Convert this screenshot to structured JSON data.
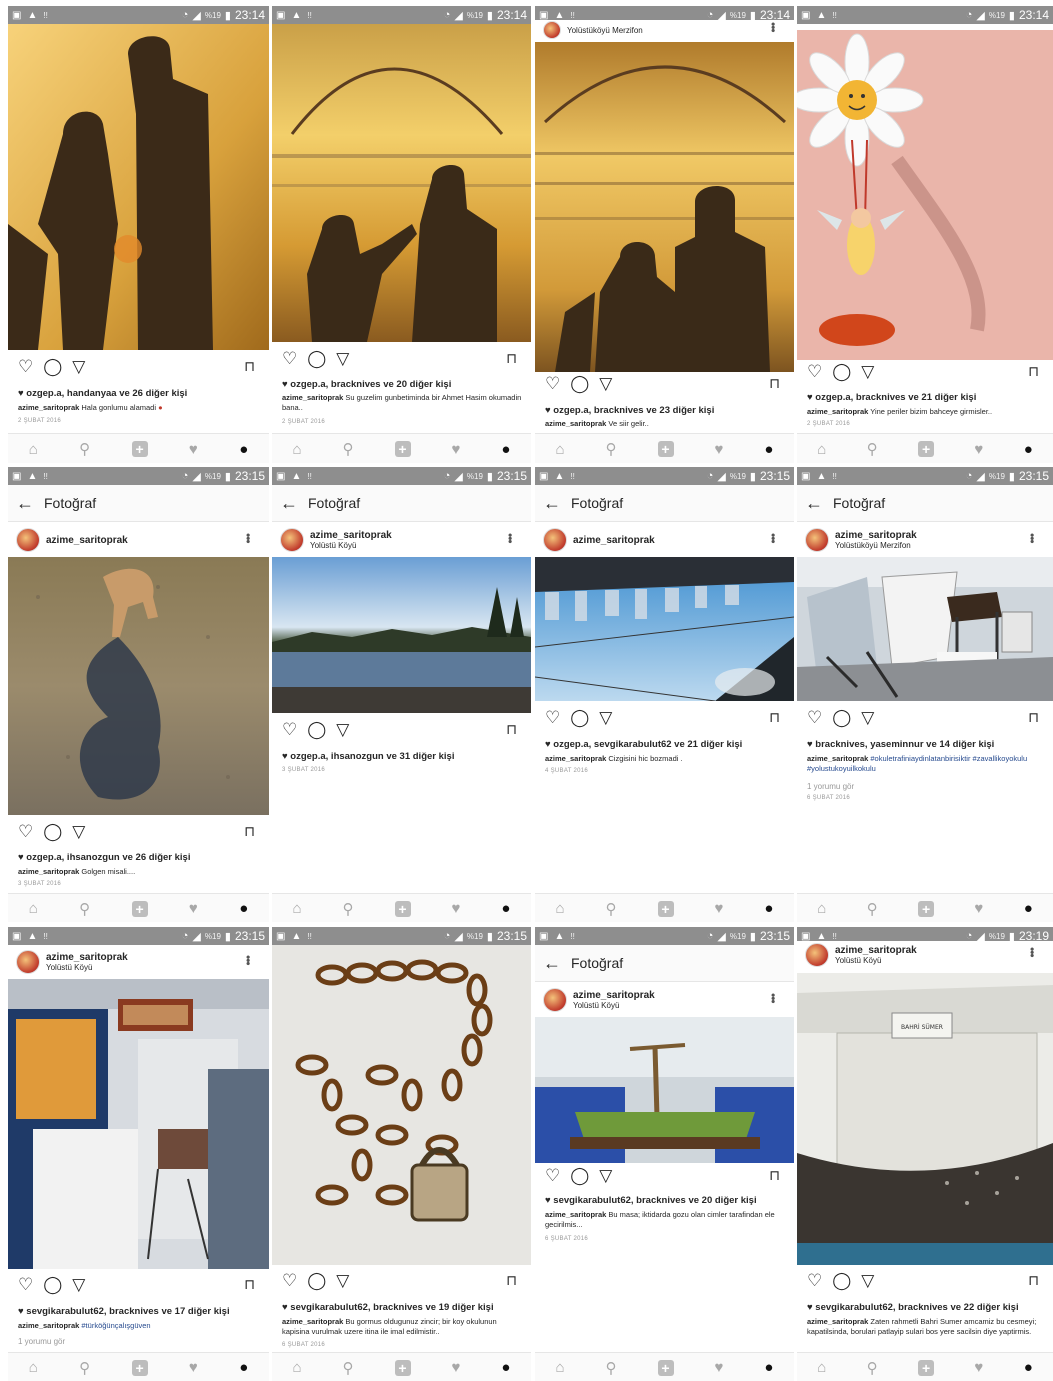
{
  "colors": {
    "status_bar": "#8e8e8e",
    "link_hashtag": "#274b8f",
    "nav_selected": "#111111",
    "nav_unselected": "#a8a8a8"
  },
  "status": {
    "signal_text": "%19",
    "warn": "!!",
    "times": {
      "r1": "23:14",
      "r2": "23:15",
      "p12": "23:19"
    }
  },
  "nav_icons": [
    "home-icon",
    "search-icon",
    "add-icon",
    "heart-icon",
    "profile-icon"
  ],
  "header": {
    "title": "Fotoğraf"
  },
  "posts": [
    {
      "likes": "ozgep.a, handanyaa ve 26 diğer kişi",
      "user": "azime_saritoprak",
      "caption": "Hala gonlumu alamadi",
      "date": "2 ŞUBAT 2016"
    },
    {
      "likes": "ozgep.a, bracknives ve 20 diğer kişi",
      "user": "azime_saritoprak",
      "caption": "Su guzelim gunbetiminda bir Ahmet Hasim okumadin bana..",
      "date": "2 ŞUBAT 2016"
    },
    {
      "top_location": "Yolüstüköyü Merzifon",
      "likes": "ozgep.a, bracknives ve 23 diğer kişi",
      "user": "azime_saritoprak",
      "caption": "Ve siir gelir.."
    },
    {
      "likes": "ozgep.a, bracknives ve 21 diğer kişi",
      "user": "azime_saritoprak",
      "caption": "Yine periler bizim bahceye girmisler..",
      "date": "2 ŞUBAT 2016"
    },
    {
      "user": "azime_saritoprak",
      "likes": "ozgep.a, ihsanozgun ve 26 diğer kişi",
      "caption": "Golgen misali....",
      "date": "3 ŞUBAT 2016"
    },
    {
      "user": "azime_saritoprak",
      "location": "Yolüstü Köyü",
      "likes": "ozgep.a, ihsanozgun ve 31 diğer kişi",
      "date": "3 ŞUBAT 2016"
    },
    {
      "user": "azime_saritoprak",
      "likes": "ozgep.a, sevgikarabulut62 ve 21 diğer kişi",
      "caption": "Cizgisini hic bozmadi .",
      "date": "4 ŞUBAT 2016"
    },
    {
      "user": "azime_saritoprak",
      "location": "Yolüstüköyü Merzifon",
      "likes": "bracknives, yaseminnur ve 14 diğer kişi",
      "caption": "#okuletrafiniaydinlatanbirisiktir #zavallikoyokulu #yolustukoyuilkokulu",
      "comments": "1 yorumu gör",
      "date": "6 ŞUBAT 2016"
    },
    {
      "user": "azime_saritoprak",
      "location": "Yolüstü Köyü",
      "likes": "sevgikarabulut62, bracknives ve 17 diğer kişi",
      "caption": "#türköğünçalışgüven",
      "comments": "1 yorumu gör"
    },
    {
      "likes": "sevgikarabulut62, bracknives ve 19 diğer kişi",
      "user": "azime_saritoprak",
      "caption": "Bu gormus oldugunuz zincir; bir koy okulunun kapisina vurulmak uzere itina ile imal edilmistir..",
      "date": "6 ŞUBAT 2016"
    },
    {
      "user": "azime_saritoprak",
      "location": "Yolüstü Köyü",
      "likes": "sevgikarabulut62, bracknives ve 20 diğer kişi",
      "caption": "Bu masa; iktidarda gozu olan cimler tarafindan ele gecirilmis...",
      "date": "6 ŞUBAT 2016"
    },
    {
      "user": "azime_saritoprak",
      "location": "Yolüstü Köyü",
      "likes": "sevgikarabulut62, bracknives ve 22 diğer kişi",
      "caption": "Zaten rahmetli Bahri Sumer amcamiz bu cesmeyi; kapatilsinda, borulari patlayip sulari bos yere sacilsin diye yaptirmis.",
      "sign_text": "BAHRİ SÜMER"
    }
  ]
}
